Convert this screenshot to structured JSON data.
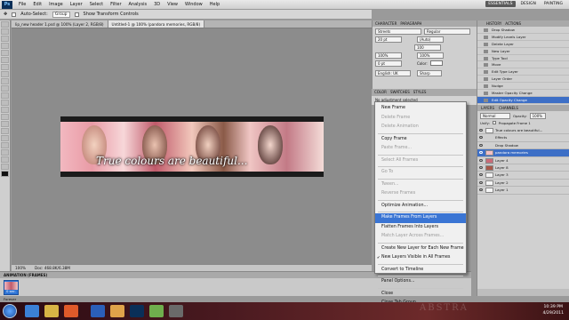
{
  "menubar": {
    "logo": "Ps",
    "items": [
      "File",
      "Edit",
      "Image",
      "Layer",
      "Select",
      "Filter",
      "Analysis",
      "3D",
      "View",
      "Window",
      "Help"
    ],
    "workspaces": [
      "ESSENTIALS",
      "DESIGN",
      "PAINTING"
    ]
  },
  "options": {
    "auto_select_label": "Auto-Select:",
    "auto_select_value": "Group",
    "show_transform_label": "Show Transform Controls"
  },
  "documents": {
    "tabs": [
      "lip_new header 1.psd @ 100% (Layer 2, RGB/8)",
      "Untitled-1 @ 100% (pandora memories, RGB/8)"
    ],
    "zoom": "100%",
    "doc_size": "Doc: 468.8K/6.38M"
  },
  "banner": {
    "text": "True colours are beautiful..."
  },
  "animation": {
    "header": "ANIMATION (FRAMES)",
    "frame_time": "0 sec.",
    "loop": "Forever"
  },
  "character": {
    "tabs": [
      "CHARACTER",
      "PARAGRAPH"
    ],
    "font": "Streets",
    "style": "Regular",
    "size": "20 pt",
    "leading": "(Auto)",
    "tracking": "100",
    "scale_v": "100%",
    "scale_h": "100%",
    "baseline": "0 pt",
    "color_label": "Color:",
    "language": "English: UK",
    "aa": "Sharp"
  },
  "mid_panel": {
    "tabs": [
      "COLOR",
      "SWATCHES",
      "STYLES"
    ],
    "body_label": "No adjustment selected"
  },
  "history": {
    "tabs": [
      "HISTORY",
      "ACTIONS"
    ],
    "items": [
      "Drop Shadow",
      "Modify Levels Layer",
      "Delete Layer",
      "New Layer",
      "Type Tool",
      "Move",
      "Edit Type Layer",
      "Layer Order",
      "Nudge",
      "Master Opacity Change",
      "Edit Opacity Change"
    ]
  },
  "layers": {
    "tabs": [
      "LAYERS",
      "CHANNELS"
    ],
    "blend_mode": "Normal",
    "opacity_label": "Opacity:",
    "opacity_value": "100%",
    "unify_label": "Unify:",
    "propagate_label": "Propagate Frame 1",
    "rows": [
      {
        "name": "True colours are beautiful...",
        "active": false
      },
      {
        "name": "Effects",
        "active": false
      },
      {
        "name": "Drop Shadow",
        "active": false
      },
      {
        "name": "pandora memories",
        "active": true
      },
      {
        "name": "Layer 4",
        "active": false
      },
      {
        "name": "Layer 8",
        "active": false
      },
      {
        "name": "Layer 3",
        "active": false
      },
      {
        "name": "Layer 2",
        "active": false
      },
      {
        "name": "Layer 1",
        "active": false
      }
    ]
  },
  "context_menu": {
    "items": [
      {
        "label": "New Frame",
        "state": "normal"
      },
      {
        "label": "Delete Frame",
        "state": "disabled"
      },
      {
        "label": "Delete Animation",
        "state": "disabled"
      },
      {
        "sep": true
      },
      {
        "label": "Copy Frame",
        "state": "normal"
      },
      {
        "label": "Paste Frame...",
        "state": "disabled"
      },
      {
        "sep": true
      },
      {
        "label": "Select All Frames",
        "state": "disabled"
      },
      {
        "sep": true
      },
      {
        "label": "Go To",
        "state": "disabled"
      },
      {
        "sep": true
      },
      {
        "label": "Tween...",
        "state": "disabled"
      },
      {
        "label": "Reverse Frames",
        "state": "disabled"
      },
      {
        "sep": true
      },
      {
        "label": "Optimize Animation...",
        "state": "normal"
      },
      {
        "sep": true
      },
      {
        "label": "Make Frames From Layers",
        "state": "highlight"
      },
      {
        "label": "Flatten Frames Into Layers",
        "state": "normal"
      },
      {
        "label": "Match Layer Across Frames...",
        "state": "disabled"
      },
      {
        "sep": true
      },
      {
        "label": "Create New Layer for Each New Frame",
        "state": "normal"
      },
      {
        "label": "New Layers Visible in All Frames",
        "state": "checked"
      },
      {
        "sep": true
      },
      {
        "label": "Convert to Timeline",
        "state": "normal"
      },
      {
        "sep": true
      },
      {
        "label": "Panel Options...",
        "state": "normal"
      },
      {
        "sep": true
      },
      {
        "label": "Close",
        "state": "normal"
      },
      {
        "label": "Close Tab Group",
        "state": "normal"
      }
    ]
  },
  "taskbar": {
    "time": "10:39 PM",
    "date": "4/29/2011",
    "brand": "ABSTRA"
  }
}
